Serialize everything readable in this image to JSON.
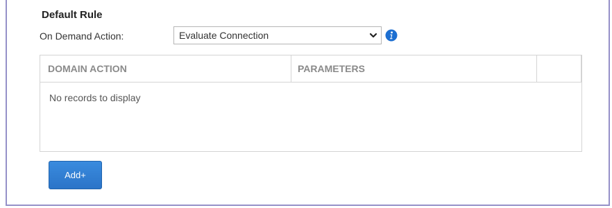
{
  "section": {
    "title": "Default Rule"
  },
  "on_demand": {
    "label": "On Demand Action:",
    "selected_value": "Evaluate Connection",
    "dropdown_icon": "chevron-down-icon",
    "info_icon": "info-icon"
  },
  "grid": {
    "columns": [
      "DOMAIN ACTION",
      "PARAMETERS",
      ""
    ],
    "empty_message": "No records to display"
  },
  "actions": {
    "add_label": "Add+"
  },
  "colors": {
    "frame_border": "#9590c8",
    "button_blue": "#2b74c8",
    "info_blue": "#1d6fd1",
    "header_text": "#8a8a8a"
  }
}
